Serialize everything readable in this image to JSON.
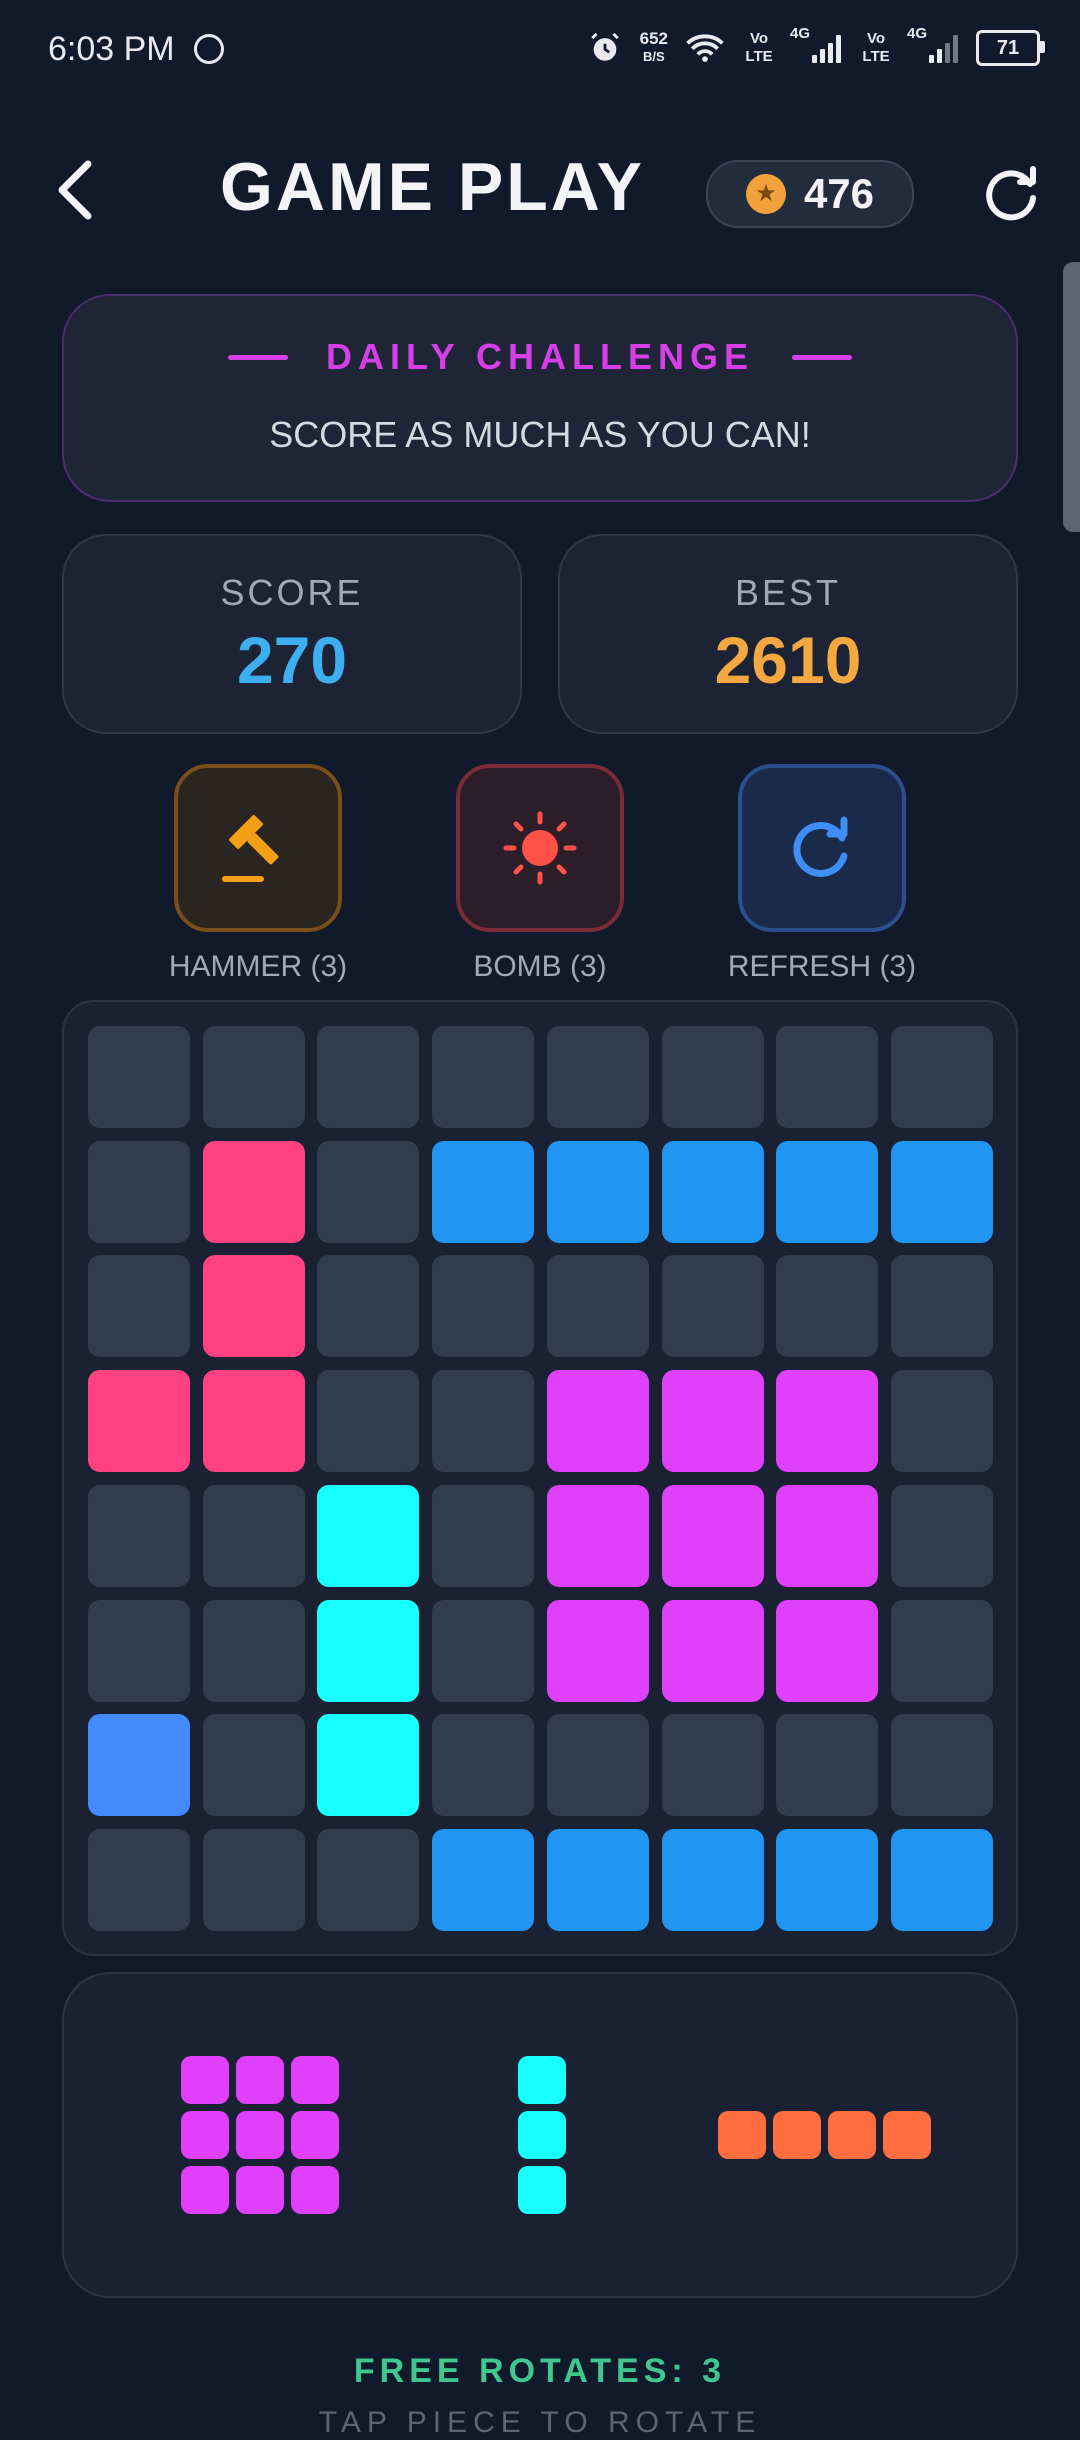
{
  "status_bar": {
    "time": "6:03 PM",
    "net_speed": "652",
    "net_unit": "B/S",
    "sim1": "Vo LTE",
    "sim1_net": "4G",
    "sim2": "Vo LTE",
    "sim2_net": "4G",
    "battery": "71"
  },
  "header": {
    "title": "GAME PLAY",
    "coins": "476"
  },
  "challenge": {
    "title": "DAILY CHALLENGE",
    "subtitle": "SCORE AS MUCH AS YOU CAN!"
  },
  "stats": {
    "score_label": "SCORE",
    "score_value": "270",
    "best_label": "BEST",
    "best_value": "2610"
  },
  "powerups": [
    {
      "label": "HAMMER (3)",
      "icon": "hammer-icon"
    },
    {
      "label": "BOMB (3)",
      "icon": "bomb-icon"
    },
    {
      "label": "REFRESH (3)",
      "icon": "refresh-icon"
    }
  ],
  "colors": {
    "empty": "#323c4f",
    "pink": "#ff4181",
    "blue": "#2196f3",
    "magenta": "#e040fb",
    "cyan": "#18ffff",
    "royal": "#448aff",
    "orange": "#ff6e40",
    "score": "#3daef0",
    "best": "#f5a742"
  },
  "board": {
    "rows": 8,
    "cols": 8,
    "grid": [
      [
        "",
        "",
        "",
        "",
        "",
        "",
        "",
        ""
      ],
      [
        "",
        "pink",
        "",
        "blue",
        "blue",
        "blue",
        "blue",
        "blue"
      ],
      [
        "",
        "pink",
        "",
        "",
        "",
        "",
        "",
        ""
      ],
      [
        "pink",
        "pink",
        "",
        "",
        "magenta",
        "magenta",
        "magenta",
        ""
      ],
      [
        "",
        "",
        "cyan",
        "",
        "magenta",
        "magenta",
        "magenta",
        ""
      ],
      [
        "",
        "",
        "cyan",
        "",
        "magenta",
        "magenta",
        "magenta",
        ""
      ],
      [
        "royal",
        "",
        "cyan",
        "",
        "",
        "",
        "",
        ""
      ],
      [
        "",
        "",
        "",
        "blue",
        "blue",
        "blue",
        "blue",
        "blue"
      ]
    ]
  },
  "tray": [
    {
      "color": "magenta",
      "shape": [
        [
          1,
          1,
          1
        ],
        [
          1,
          1,
          1
        ],
        [
          1,
          1,
          1
        ]
      ]
    },
    {
      "color": "cyan",
      "shape": [
        [
          1
        ],
        [
          1
        ],
        [
          1
        ]
      ]
    },
    {
      "color": "orange",
      "shape": [
        [
          1,
          1,
          1,
          1
        ]
      ]
    }
  ],
  "footer": {
    "free_rotates": "FREE ROTATES: 3",
    "hint": "TAP PIECE TO ROTATE"
  }
}
